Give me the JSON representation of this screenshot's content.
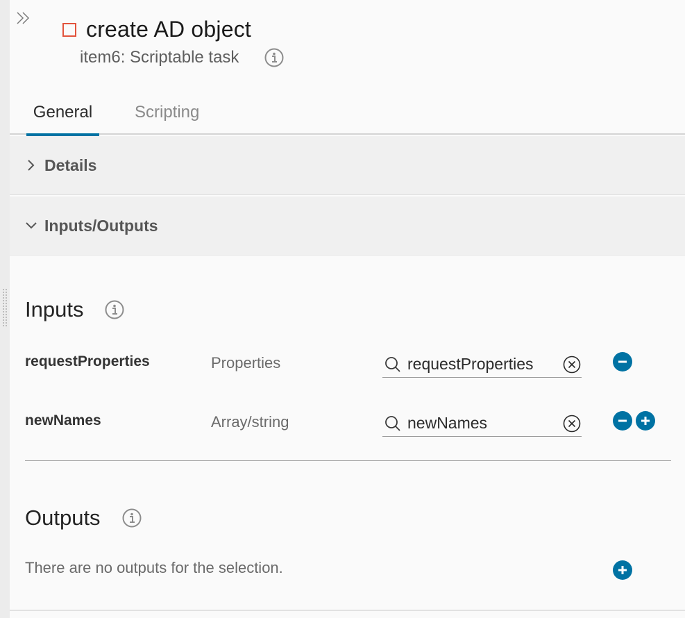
{
  "header": {
    "title": "create AD object",
    "subtitle": "item6: Scriptable task"
  },
  "tabs": [
    {
      "label": "General",
      "active": true
    },
    {
      "label": "Scripting",
      "active": false
    }
  ],
  "sections": {
    "details": {
      "label": "Details",
      "expanded": false
    },
    "io": {
      "label": "Inputs/Outputs",
      "expanded": true
    }
  },
  "inputs": {
    "heading": "Inputs",
    "rows": [
      {
        "name": "requestProperties",
        "type": "Properties",
        "value": "requestProperties"
      },
      {
        "name": "newNames",
        "type": "Array/string",
        "value": "newNames"
      }
    ]
  },
  "outputs": {
    "heading": "Outputs",
    "empty_text": "There are no outputs for the selection."
  },
  "colors": {
    "accent": "#0072a3",
    "task_icon": "#e2533c"
  }
}
